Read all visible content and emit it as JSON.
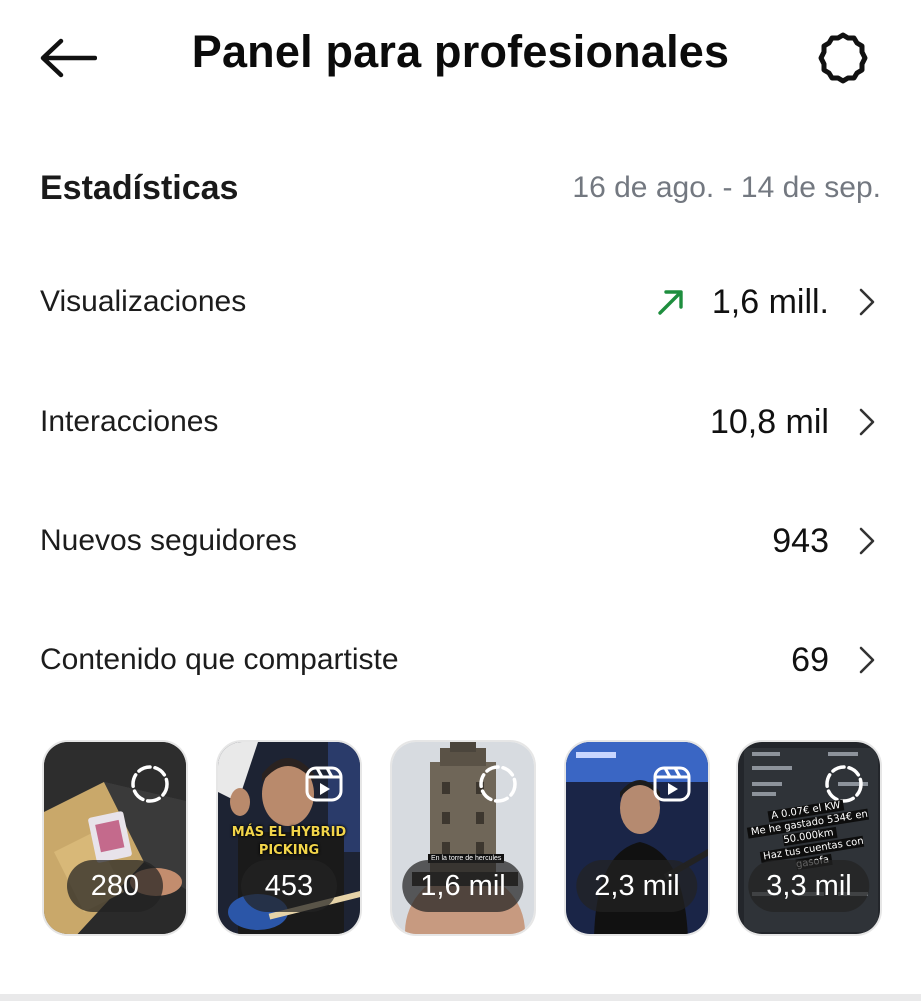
{
  "header": {
    "title": "Panel para profesionales",
    "back_icon": "arrow-left-icon",
    "settings_icon": "gear-icon"
  },
  "stats": {
    "title": "Estadísticas",
    "date_range": "16 de ago. - 14 de sep."
  },
  "metrics": [
    {
      "label": "Visualizaciones",
      "value": "1,6 mill.",
      "trend": "up",
      "trend_color": "#1e8e3e"
    },
    {
      "label": "Interacciones",
      "value": "10,8 mil"
    },
    {
      "label": "Nuevos seguidores",
      "value": "943"
    },
    {
      "label": "Contenido que compartiste",
      "value": "69"
    }
  ],
  "thumbnails": [
    {
      "count": "280",
      "type": "story",
      "type_icon": "story-ring-icon"
    },
    {
      "count": "453",
      "type": "reel",
      "type_icon": "reels-icon",
      "overlay_text_1": "MÁS EL HYBRID",
      "overlay_text_2": "PICKING"
    },
    {
      "count": "1,6 mil",
      "type": "story",
      "type_icon": "story-ring-icon",
      "caption": "En la torre de hercules"
    },
    {
      "count": "2,3 mil",
      "type": "reel",
      "type_icon": "reels-icon"
    },
    {
      "count": "3,3 mil",
      "type": "story",
      "type_icon": "story-ring-icon",
      "caption_1": "A 0.07€ el KW",
      "caption_2": "Me he gastado 534€ en 50.000km",
      "caption_3": "Haz tus cuentas con gasofa"
    }
  ],
  "colors": {
    "accent_trend": "#1e8e3e",
    "muted_text": "#737880",
    "pill_bg": "rgba(35,35,35,0.72)"
  }
}
